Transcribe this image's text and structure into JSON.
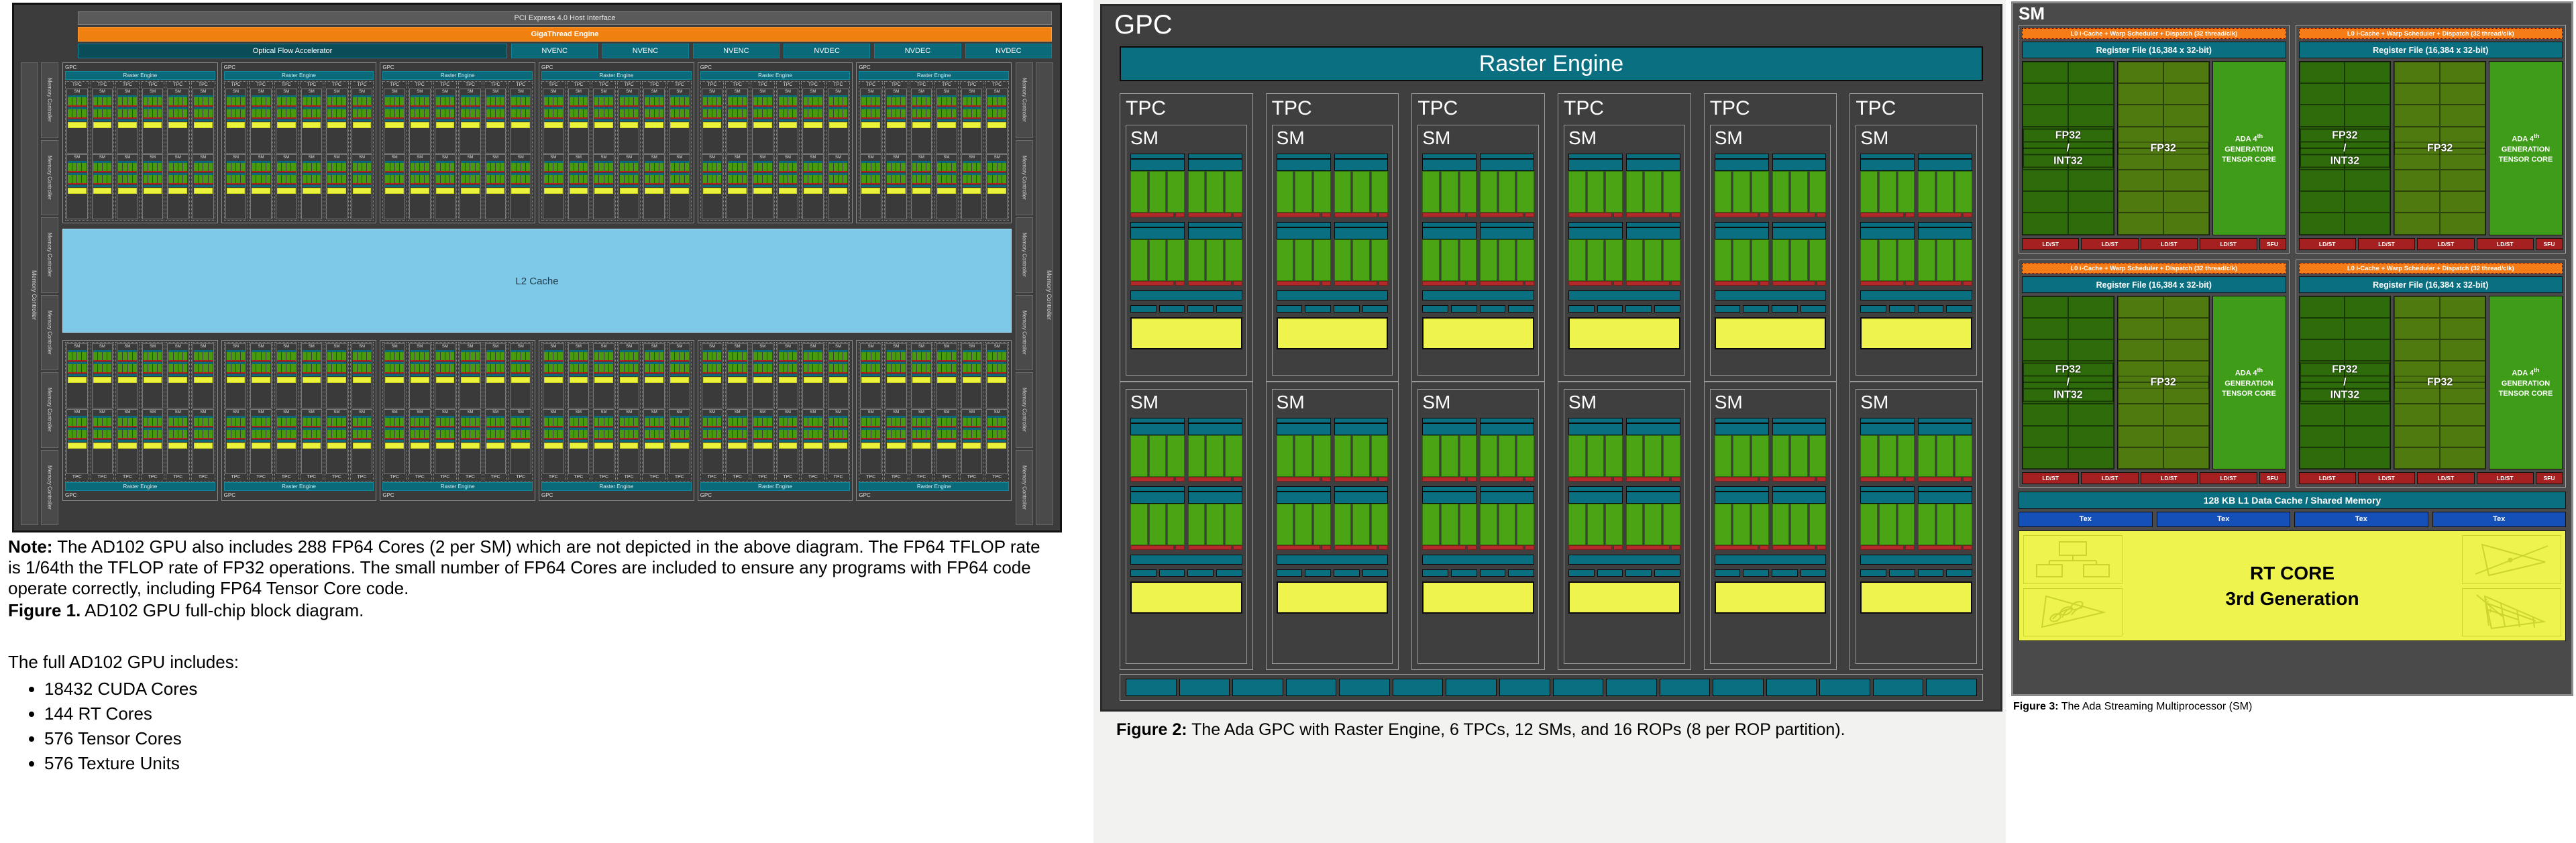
{
  "figure1": {
    "pcie": "PCI Express 4.0 Host Interface",
    "gigathread": "GigaThread Engine",
    "engines": [
      "Optical Flow Accelerator",
      "NVENC",
      "NVENC",
      "NVENC",
      "NVDEC",
      "NVDEC",
      "NVDEC"
    ],
    "memory_controller_label": "Memory Controller",
    "gpc_label": "GPC",
    "raster_label": "Raster Engine",
    "tpc_label": "TPC",
    "sm_label": "SM",
    "l2_label": "L2 Cache",
    "gpc_count_top": 6,
    "gpc_count_bottom": 6,
    "tpc_per_gpc": 6,
    "mem_cells_per_side": 6
  },
  "figure1_text": {
    "note_bold": "Note:",
    "note_body": " The AD102 GPU also includes 288 FP64 Cores (2 per SM) which are not depicted in the above diagram. The FP64 TFLOP rate is 1/64th the TFLOP rate of FP32 operations. The small number of FP64 Cores are included to ensure any programs with FP64 code operate correctly, including FP64 Tensor Core code.",
    "caption_bold": "Figure 1.",
    "caption_body": " AD102 GPU full-chip block diagram.",
    "list_intro": "The full AD102 GPU includes:",
    "bullets": [
      "18432 CUDA Cores",
      "144 RT Cores",
      "576 Tensor Cores",
      "576 Texture Units"
    ]
  },
  "figure2": {
    "gpc_label": "GPC",
    "raster_label": "Raster Engine",
    "tpc_label": "TPC",
    "sm_label": "SM",
    "tpc_count": 6,
    "sm_rows": 2,
    "rop_count": 16,
    "caption_bold": "Figure 2:",
    "caption_body": " The Ada GPC with Raster Engine, 6 TPCs, 12 SMs, and 16 ROPs (8 per ROP partition)."
  },
  "figure3": {
    "sm_label": "SM",
    "scheduler_label": "L0 i-Cache + Warp Scheduler + Dispatch (32 thread/clk)",
    "register_file_label": "Register File (16,384 x 32-bit)",
    "core_col_a_label": "FP32\n/\nINT32",
    "core_col_a_line1": "FP32",
    "core_col_a_line2": "/",
    "core_col_a_line3": "INT32",
    "core_col_b_label": "FP32",
    "tensor_core_label": "ADA 4th GENERATION TENSOR CORE",
    "tensor_line1": "ADA 4",
    "tensor_line2": "GENERATION",
    "tensor_line3": "TENSOR CORE",
    "ldst_label": "LD/ST",
    "sfu_label": "SFU",
    "ldst_count": 4,
    "l1_label": "128 KB L1 Data Cache / Shared Memory",
    "tex_label": "Tex",
    "tex_count": 4,
    "rt_line1": "RT CORE",
    "rt_line2": "3rd Generation",
    "quadrant_count": 4,
    "caption_bold": "Figure 3:",
    "caption_body": " The Ada Streaming Multiprocessor (SM)"
  },
  "colors": {
    "teal": "#0a6f80",
    "orange": "#f57c17",
    "green_core": "#4aa413",
    "green_dark": "#2e6b0b",
    "green_mid": "#4f7a10",
    "green_tensor": "#3f9c18",
    "red_ldst": "#a52121",
    "yellow_rt": "#eef44d",
    "blue_tex": "#1550b8",
    "l2_blue": "#7ec8e8",
    "frame_gray": "#3f3f3f"
  }
}
